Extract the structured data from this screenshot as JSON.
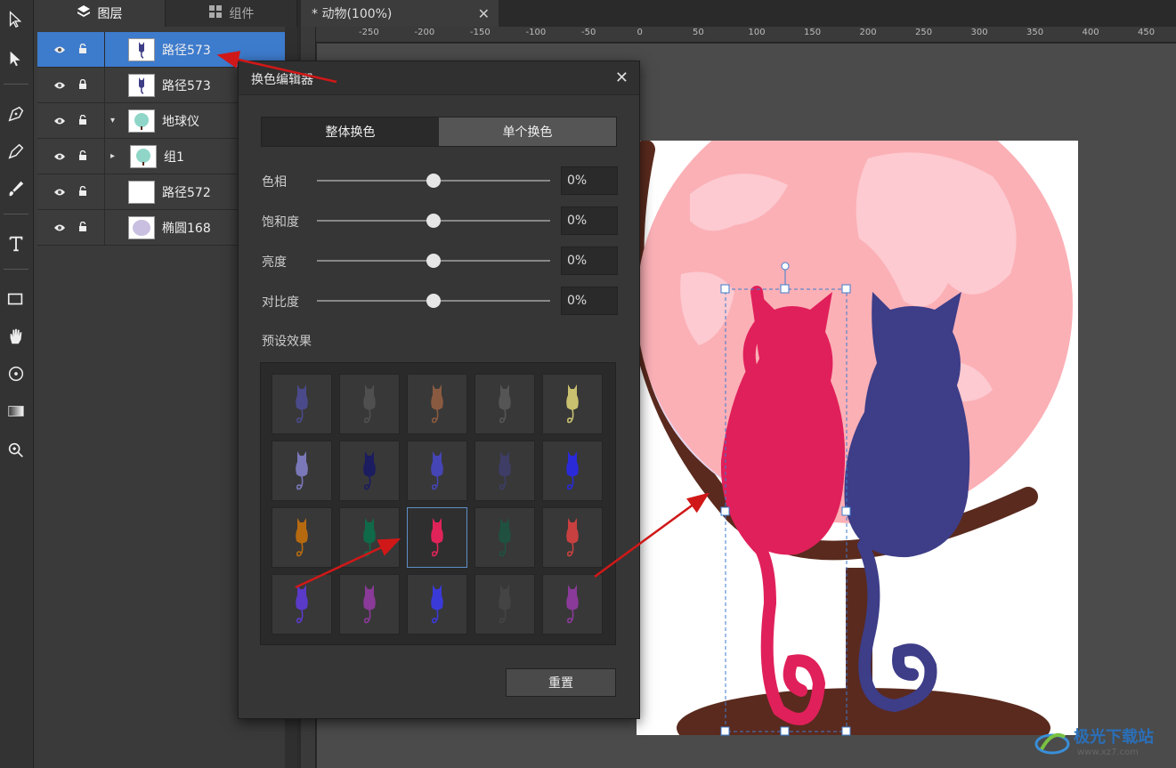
{
  "panel_tabs": {
    "layers": "图层",
    "components": "组件"
  },
  "document_tab": {
    "title": "* 动物(100%)",
    "close": "✕"
  },
  "layers": [
    {
      "name": "路径573",
      "selected": true,
      "locked": false,
      "expander": "",
      "thumb": "cat-icon"
    },
    {
      "name": "路径573",
      "selected": false,
      "locked": true,
      "expander": "",
      "thumb": "cat-icon"
    },
    {
      "name": "地球仪",
      "selected": false,
      "locked": false,
      "expander": "▾",
      "thumb": "globe-icon"
    },
    {
      "name": "组1",
      "selected": false,
      "locked": false,
      "expander": "▸",
      "thumb": "globe-icon"
    },
    {
      "name": "路径572",
      "selected": false,
      "locked": false,
      "expander": "",
      "thumb": "crescent-icon"
    },
    {
      "name": "椭圆168",
      "selected": false,
      "locked": false,
      "expander": "",
      "thumb": "ellipse-icon"
    }
  ],
  "ruler_ticks": [
    "-250",
    "-200",
    "-150",
    "-100",
    "-50",
    "0",
    "50",
    "100",
    "150",
    "200",
    "250",
    "300",
    "350",
    "400",
    "450"
  ],
  "dialog": {
    "title": "换色编辑器",
    "close": "✕",
    "mode_whole": "整体换色",
    "mode_single": "单个换色",
    "sliders": [
      {
        "label": "色相",
        "value": "0%",
        "level": 0.5
      },
      {
        "label": "饱和度",
        "value": "0%",
        "level": 0.5
      },
      {
        "label": "亮度",
        "value": "0%",
        "level": 0.5
      },
      {
        "label": "对比度",
        "value": "0%",
        "level": 0.5
      }
    ],
    "preset_title": "预设效果",
    "presets": [
      "#4a4a8a",
      "#4f4f4f",
      "#8a5a40",
      "#555555",
      "#c9c070",
      "#7a78b8",
      "#1c1c60",
      "#4545b5",
      "#3d3d66",
      "#2a2ad8",
      "#b56a10",
      "#0f6a4a",
      "#e0245a",
      "#1f5040",
      "#c84040",
      "#5a3ac8",
      "#8a3a98",
      "#3a3ad8",
      "#444444",
      "#8a3a98"
    ],
    "selected_preset": 12,
    "reset": "重置"
  },
  "watermark": {
    "text": "极光下载站",
    "url": "www.xz7.com"
  },
  "colors": {
    "selected_layer": "#3d7bcc",
    "globe": "#fbb0b6",
    "cat_left": "#e0205a",
    "cat_right": "#3d3d88",
    "stand": "#5a2a1e",
    "arrow": "#d01818"
  }
}
